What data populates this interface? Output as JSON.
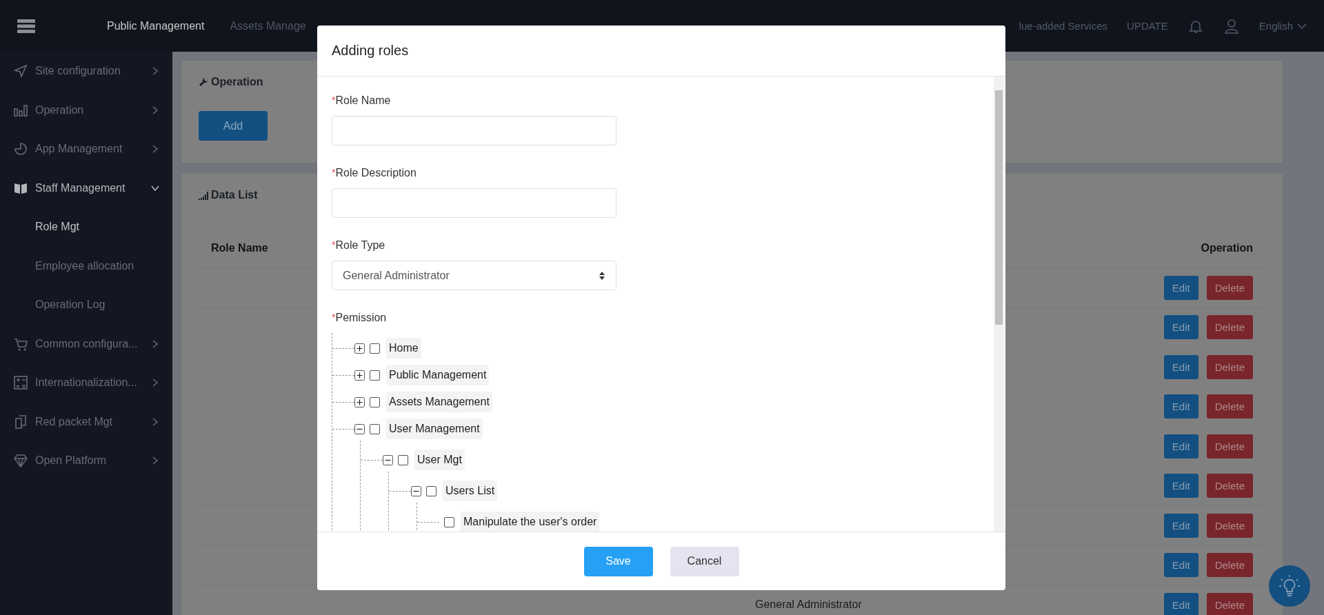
{
  "top_nav": {
    "items": [
      {
        "label": "Public Management",
        "selected": true
      },
      {
        "label": "Assets Manage",
        "selected": false
      }
    ],
    "right": [
      {
        "kind": "link",
        "label": "lue-added Services"
      },
      {
        "kind": "link",
        "label": "UPDATE"
      },
      {
        "kind": "bell"
      },
      {
        "kind": "user"
      },
      {
        "kind": "language",
        "label": "English"
      }
    ]
  },
  "sidebar": {
    "items": [
      {
        "label": "Site configuration",
        "expanded": false
      },
      {
        "label": "Operation",
        "expanded": false
      },
      {
        "label": "App Management",
        "expanded": false
      },
      {
        "label": "Staff Management",
        "expanded": true,
        "children": [
          {
            "label": "Role Mgt",
            "selected": true
          },
          {
            "label": "Employee allocation",
            "selected": false
          },
          {
            "label": "Operation Log",
            "selected": false
          }
        ]
      },
      {
        "label": "Common configura...",
        "expanded": false
      },
      {
        "label": "Internationalization...",
        "expanded": false
      },
      {
        "label": "Red packet Mgt",
        "expanded": false
      },
      {
        "label": "Open Platform",
        "expanded": false
      }
    ]
  },
  "operation_card": {
    "title": "Operation",
    "button": "Add"
  },
  "data_card": {
    "title": "Data List",
    "columns": [
      "Role Name",
      "Operation"
    ],
    "rows": [
      {
        "edit": "Edit",
        "delete": "Delete"
      },
      {
        "edit": "Edit",
        "delete": "Delete"
      },
      {
        "edit": "Edit",
        "delete": "Delete"
      },
      {
        "edit": "Edit",
        "delete": "Delete"
      },
      {
        "edit": "Edit",
        "delete": "Delete"
      },
      {
        "edit": "Edit",
        "delete": "Delete"
      },
      {
        "edit": "Edit",
        "delete": "Delete"
      },
      {
        "edit": "Edit",
        "delete": "Delete"
      },
      {
        "role_type": "General Administrator",
        "edit": "Edit",
        "delete": "Delete"
      }
    ]
  },
  "modal": {
    "title": "Adding roles",
    "fields": [
      {
        "kind": "input",
        "required_mark": "*",
        "label": "Role Name"
      },
      {
        "kind": "input",
        "required_mark": "*",
        "label": "Role Description"
      },
      {
        "kind": "select",
        "required_mark": "*",
        "label": "Role Type",
        "value": "General Administrator"
      },
      {
        "kind": "tree",
        "required_mark": "*",
        "label": "Pemission",
        "tree": [
          {
            "label": "Home",
            "expanded": false,
            "checked": false
          },
          {
            "label": "Public Management",
            "expanded": false,
            "checked": false
          },
          {
            "label": "Assets Management",
            "expanded": false,
            "checked": false
          },
          {
            "label": "User Management",
            "expanded": true,
            "checked": false,
            "children": [
              {
                "label": "User Mgt",
                "expanded": true,
                "checked": false,
                "children": [
                  {
                    "label": "Users List",
                    "expanded": true,
                    "checked": false,
                    "children": [
                      {
                        "label": "Manipulate the user's order",
                        "checked": false
                      }
                    ]
                  }
                ]
              }
            ]
          }
        ]
      }
    ],
    "buttons": [
      {
        "kind": "primary",
        "label": "Save"
      },
      {
        "kind": "secondary",
        "label": "Cancel"
      }
    ]
  }
}
